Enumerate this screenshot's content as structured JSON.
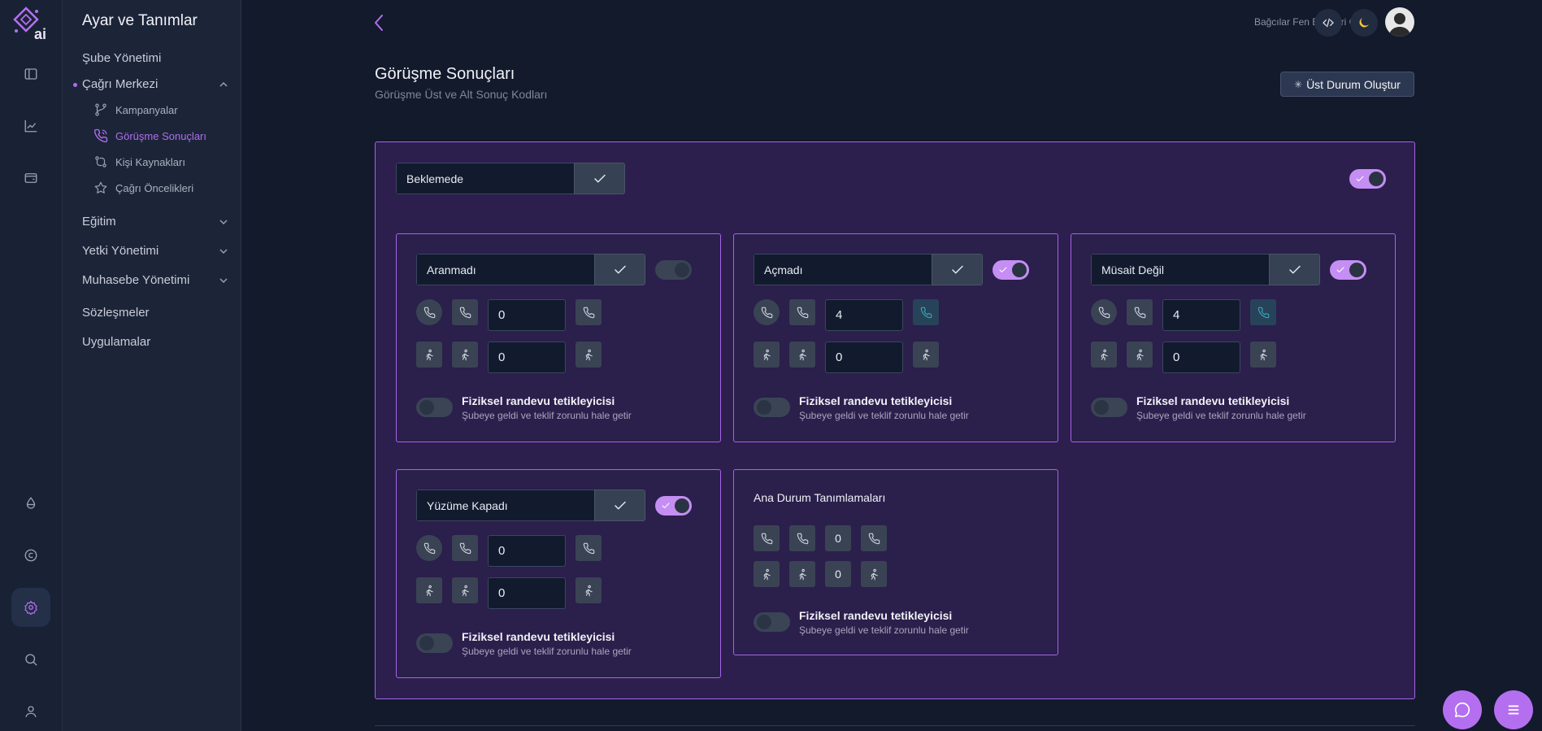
{
  "sidebar": {
    "title": "Ayar ve Tanımlar",
    "items": [
      {
        "label": "Şube Yönetimi"
      },
      {
        "label": "Çağrı Merkezi"
      },
      {
        "label": "Eğitim"
      },
      {
        "label": "Yetki Yönetimi"
      },
      {
        "label": "Muhasebe Yönetimi"
      },
      {
        "label": "Sözleşmeler"
      },
      {
        "label": "Uygulamalar"
      }
    ],
    "sub_items": [
      {
        "label": "Kampanyalar",
        "icon": "git-branch-icon"
      },
      {
        "label": "Görüşme Sonuçları",
        "icon": "phone-call-icon",
        "active": true
      },
      {
        "label": "Kişi Kaynakları",
        "icon": "git-compare-icon"
      },
      {
        "label": "Çağrı Öncelikleri",
        "icon": "star-icon"
      }
    ]
  },
  "rail_icons": [
    "sidebar-icon",
    "chart-icon",
    "wallet-icon",
    "droplet-icon",
    "copyright-icon",
    "settings-icon",
    "search-icon",
    "user-icon"
  ],
  "header": {
    "school": "Bağcılar Fen Bilimleri Gold"
  },
  "page": {
    "title": "Görüşme Sonuçları",
    "subtitle": "Görüşme Üst ve Alt Sonuç Kodları",
    "create_button": "Üst Durum Oluştur"
  },
  "parent_status": {
    "name": "Beklemede",
    "enabled": true
  },
  "trigger": {
    "title": "Fiziksel randevu tetikleyicisi",
    "subtitle": "Şubeye geldi ve teklif zorunlu hale getir"
  },
  "cards": [
    {
      "name": "Aranmadı",
      "enabled": false,
      "call_count": "0",
      "visit_count": "0",
      "trigger": false
    },
    {
      "name": "Açmadı",
      "enabled": true,
      "call_count": "4",
      "visit_count": "0",
      "trigger": false
    },
    {
      "name": "Müsait Değil",
      "enabled": true,
      "call_count": "4",
      "visit_count": "0",
      "trigger": false
    },
    {
      "name": "Yüzüme Kapadı",
      "enabled": true,
      "call_count": "0",
      "visit_count": "0",
      "trigger": false
    }
  ],
  "main_definitions": {
    "title": "Ana Durum Tanımlamaları",
    "call_count": "0",
    "visit_count": "0"
  },
  "colors": {
    "accent": "#b46ff0",
    "background": "#121a2c",
    "card": "#2b1f4c",
    "border": "#a664e8"
  }
}
